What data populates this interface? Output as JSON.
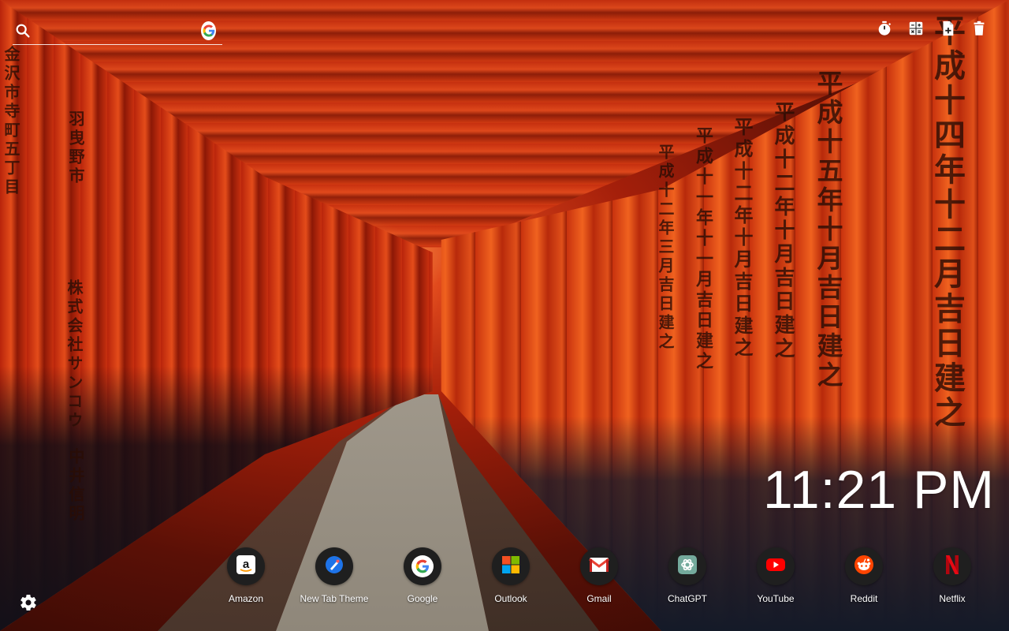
{
  "search": {
    "placeholder": "",
    "icon": "search-icon",
    "engine_icon": "google-icon"
  },
  "toolbar": {
    "items": [
      {
        "name": "timer",
        "icon": "stopwatch-icon"
      },
      {
        "name": "calculator",
        "icon": "calculator-icon"
      },
      {
        "name": "new-note",
        "icon": "note-add-icon"
      },
      {
        "name": "trash",
        "icon": "trash-icon"
      }
    ]
  },
  "clock": {
    "time": "11:21 PM"
  },
  "settings": {
    "icon": "gear-icon"
  },
  "shortcuts": [
    {
      "label": "Amazon",
      "icon": "amazon-icon"
    },
    {
      "label": "New Tab Theme",
      "icon": "new-tab-theme-icon"
    },
    {
      "label": "Google",
      "icon": "google-icon"
    },
    {
      "label": "Outlook",
      "icon": "microsoft-icon"
    },
    {
      "label": "Gmail",
      "icon": "gmail-icon"
    },
    {
      "label": "ChatGPT",
      "icon": "chatgpt-icon"
    },
    {
      "label": "YouTube",
      "icon": "youtube-icon"
    },
    {
      "label": "Reddit",
      "icon": "reddit-icon"
    },
    {
      "label": "Netflix",
      "icon": "netflix-icon"
    }
  ],
  "wallpaper": {
    "inscriptions": [
      "平成十四年十二月吉日建之",
      "平成十五年十月吉日建之",
      "平成十二年十月吉日建之",
      "平成十二年十月吉日建之",
      "平成十一年十一月吉日建之",
      "平成十二年三月吉日建之",
      "羽曳野市",
      "株式会社サンコウ",
      "中井信明",
      "金沢市寺町五丁目"
    ]
  },
  "colors": {
    "shortcut_bg": "#1f1f1f",
    "text": "#ffffff",
    "accent_red": "#e04a1a"
  }
}
